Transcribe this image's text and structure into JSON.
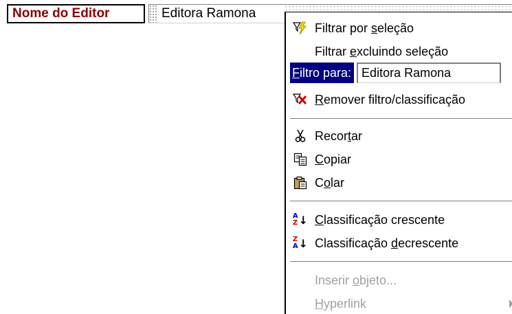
{
  "form": {
    "field_label": "Nome do Editor",
    "field_value": "Editora Ramona"
  },
  "menu": {
    "filter_by_selection": {
      "before": "Filtrar por ",
      "key": "s",
      "after": "eleção",
      "icon": "filter-lightning-icon"
    },
    "filter_excluding": {
      "before": "Filtrar ",
      "key": "e",
      "after": "xcluindo seleção"
    },
    "filter_for": {
      "key": "F",
      "after": "iltro para:",
      "value": "Editora Ramona"
    },
    "remove_filter": {
      "before": "",
      "key": "R",
      "after": "emover filtro/classificação",
      "icon": "remove-filter-icon"
    },
    "cut": {
      "before": "Recor",
      "key": "t",
      "after": "ar",
      "icon": "scissors-icon"
    },
    "copy": {
      "before": "",
      "key": "C",
      "after": "opiar",
      "icon": "copy-icon"
    },
    "paste": {
      "before": "C",
      "key": "o",
      "after": "lar",
      "icon": "paste-icon"
    },
    "sort_asc": {
      "before": "",
      "key": "C",
      "after": "lassificação crescente",
      "icon": "sort-ascending-icon",
      "letters": [
        "A",
        "Z"
      ]
    },
    "sort_desc": {
      "before": "Classificação ",
      "key": "d",
      "after": "ecrescente",
      "icon": "sort-descending-icon",
      "letters": [
        "Z",
        "A"
      ]
    },
    "insert_object": {
      "before": "Inserir ",
      "key": "o",
      "after": "bjeto...",
      "disabled": true
    },
    "hyperlink": {
      "before": "",
      "key": "H",
      "after": "yperlink",
      "disabled": true
    }
  },
  "colors": {
    "label_text": "#8b0000",
    "highlight": "#000080",
    "disabled_text": "#a0a0a0"
  }
}
